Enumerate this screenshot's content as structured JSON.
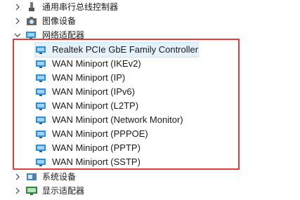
{
  "tree": {
    "categories_top": [
      {
        "label": "通用串行总线控制器",
        "icon": "usb-controller-icon",
        "expanded": false
      },
      {
        "label": "图像设备",
        "icon": "camera-icon",
        "expanded": false
      },
      {
        "label": "网络适配器",
        "icon": "network-adapter-icon",
        "expanded": true
      }
    ],
    "adapters": [
      {
        "label": "Realtek PCIe GbE Family Controller",
        "selected": true
      },
      {
        "label": "WAN Miniport (IKEv2)"
      },
      {
        "label": "WAN Miniport (IP)"
      },
      {
        "label": "WAN Miniport (IPv6)"
      },
      {
        "label": "WAN Miniport (L2TP)"
      },
      {
        "label": "WAN Miniport (Network Monitor)"
      },
      {
        "label": "WAN Miniport (PPPOE)"
      },
      {
        "label": "WAN Miniport (PPTP)"
      },
      {
        "label": "WAN Miniport (SSTP)"
      }
    ],
    "categories_bottom": [
      {
        "label": "系统设备",
        "icon": "system-device-icon",
        "expanded": false
      },
      {
        "label": "显示适配器",
        "icon": "display-adapter-icon",
        "expanded": false
      }
    ]
  },
  "colors": {
    "highlight_border": "#e03c3c",
    "selection_bg": "#e5f1fb",
    "adapter_icon": "#2e8fd6"
  }
}
